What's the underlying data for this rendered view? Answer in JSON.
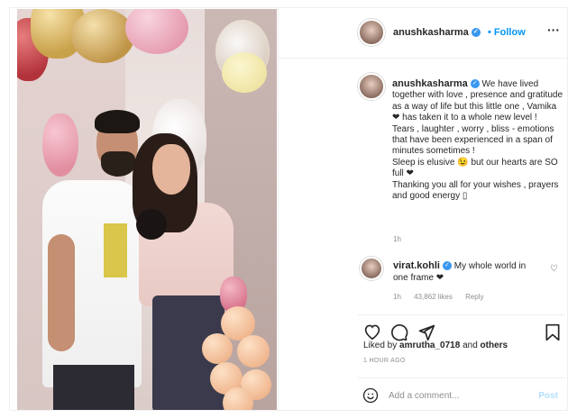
{
  "post": {
    "author": {
      "username": "anushkasharma",
      "verified": true,
      "follow_label": "Follow",
      "more_icon": "more-options-icon"
    },
    "caption": {
      "username": "anushkasharma",
      "lines": [
        "We have lived together with love , presence and gratitude as a way of life but this little one , Vamika ❤ has taken it to a whole new level !",
        "Tears , laughter , worry , bliss - emotions that have been experienced in a span of minutes sometimes !",
        "Sleep is elusive 😉 but our hearts are SO full ❤",
        "Thanking you all for your wishes , prayers and good energy ▯"
      ],
      "time": "1h"
    },
    "comment": {
      "username": "virat.kohli",
      "verified": true,
      "text": "My whole world in one frame ❤",
      "time": "1h",
      "likes": "43,862 likes",
      "reply": "Reply"
    },
    "actions": {
      "like_icon": "heart-icon",
      "comment_icon": "comment-icon",
      "share_icon": "share-icon",
      "save_icon": "bookmark-icon"
    },
    "liked_by": {
      "prefix": "Liked by",
      "user": "amrutha_0718",
      "connector": "and",
      "others": "others"
    },
    "timestamp": "1 HOUR AGO",
    "add_comment": {
      "placeholder": "Add a comment...",
      "post_label": "Post"
    }
  }
}
